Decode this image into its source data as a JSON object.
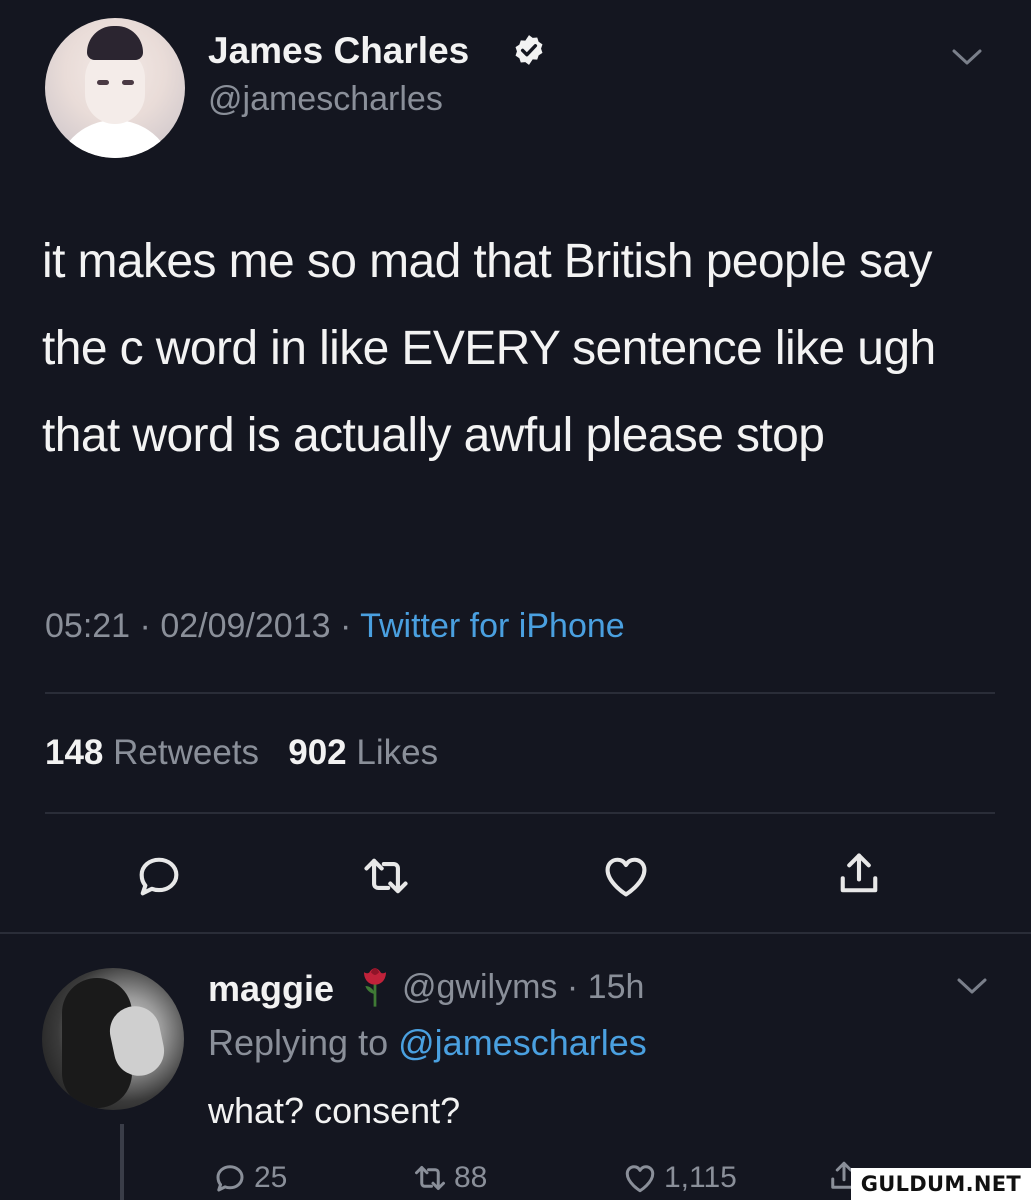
{
  "tweet": {
    "author": {
      "name": "James Charles",
      "handle": "@jamescharles",
      "verified": true
    },
    "text": "it makes me so mad that British people say the c word in like EVERY sentence like ugh that word is actually awful please stop",
    "time": "05:21",
    "date": "02/09/2013",
    "source": "Twitter for iPhone",
    "retweets_count": "148",
    "retweets_label": "Retweets",
    "likes_count": "902",
    "likes_label": "Likes"
  },
  "reply": {
    "name": "maggie",
    "handle": "@gwilyms",
    "age": "15h",
    "replying_to_label": "Replying to",
    "replying_to_handle": "@jamescharles",
    "text": "what? consent?",
    "replies": "25",
    "retweets": "88",
    "likes": "1,115"
  },
  "icons": {
    "verified": "verified-badge-icon",
    "menu": "chevron-down-icon",
    "reply": "reply-bubble-icon",
    "retweet": "retweet-arrows-icon",
    "like": "heart-icon",
    "share": "share-upload-icon",
    "emoji": "rose-emoji"
  },
  "colors": {
    "background": "#141620",
    "text_primary": "#f2f2f2",
    "text_secondary": "#8a8f99",
    "link": "#4aa0e0"
  },
  "watermark": "GULDUM.NET"
}
